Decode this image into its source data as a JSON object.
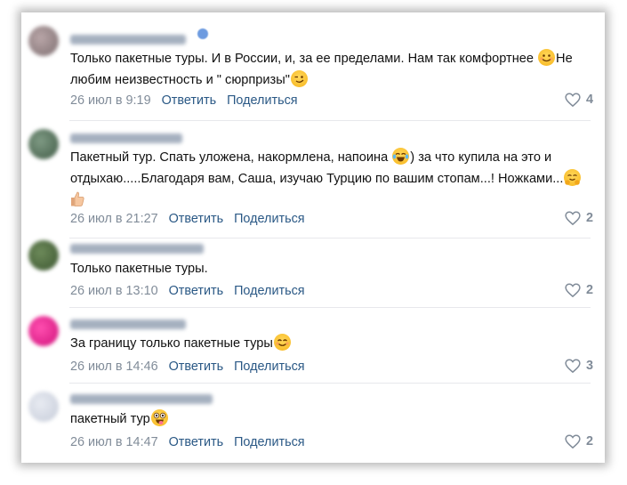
{
  "comments": [
    {
      "text_a": "Только пакетные туры. И в России, и, за ее пределами. Нам так комфортнее ",
      "text_b": "Не любим неизвестность и \" сюрпризы\"",
      "date": "26 июл в 9:19",
      "reply": "Ответить",
      "share": "Поделиться",
      "likes": "4"
    },
    {
      "text_a": "Пакетный тур. Спать уложена, накормлена, напоина ",
      "text_b": ") за что купила на это и отдыхаю.....Благодаря вам, Саша, изучаю Турцию по вашим стопам...! Ножками...",
      "date": "26 июл в 21:27",
      "reply": "Ответить",
      "share": "Поделиться",
      "likes": "2"
    },
    {
      "text_a": "Только пакетные туры.",
      "date": "26 июл в 13:10",
      "reply": "Ответить",
      "share": "Поделиться",
      "likes": "2"
    },
    {
      "text_a": "За границу только пакетные туры",
      "date": "26 июл в 14:46",
      "reply": "Ответить",
      "share": "Поделиться",
      "likes": "3"
    },
    {
      "text_a": "пакетный тур",
      "date": "26 июл в 14:47",
      "reply": "Ответить",
      "share": "Поделиться",
      "likes": "2"
    }
  ],
  "colors": {
    "link": "#2a5885",
    "meta": "#818c99",
    "text": "#111111"
  }
}
